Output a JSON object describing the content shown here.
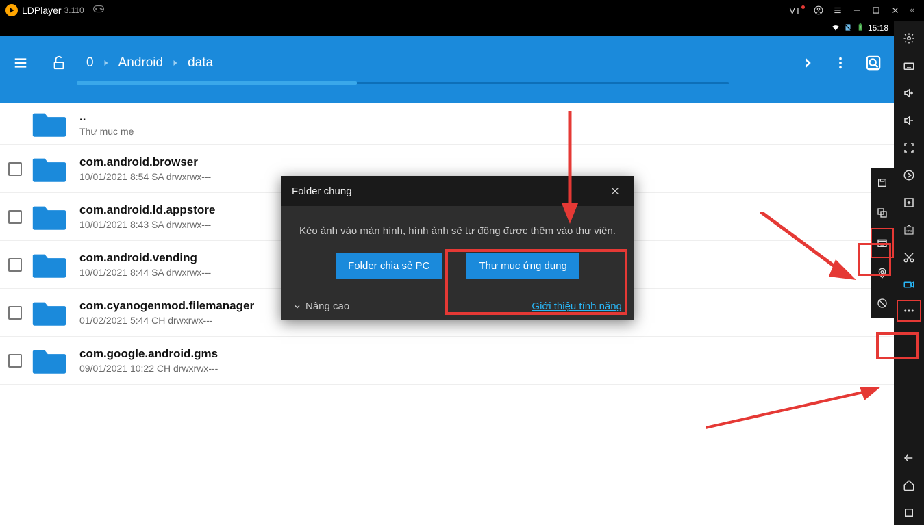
{
  "titlebar": {
    "app_name": "LDPlayer",
    "version": "3.110",
    "vt_label": "VT"
  },
  "statusbar": {
    "time": "15:18"
  },
  "header": {
    "breadcrumb": [
      "0",
      "Android",
      "data"
    ]
  },
  "files": {
    "parent_name": "..",
    "parent_sub": "Thư mục mẹ",
    "items": [
      {
        "name": "com.android.browser",
        "meta": "10/01/2021 8:54 SA   drwxrwx---"
      },
      {
        "name": "com.android.ld.appstore",
        "meta": "10/01/2021 8:43 SA   drwxrwx---"
      },
      {
        "name": "com.android.vending",
        "meta": "10/01/2021 8:44 SA   drwxrwx---"
      },
      {
        "name": "com.cyanogenmod.filemanager",
        "meta": "01/02/2021 5:44 CH   drwxrwx---"
      },
      {
        "name": "com.google.android.gms",
        "meta": "09/01/2021 10:22 CH   drwxrwx---"
      }
    ]
  },
  "dialog": {
    "title": "Folder chung",
    "desc": "Kéo ảnh vào màn hình, hình ảnh sẽ tự động được thêm vào thư viện.",
    "btn_pc": "Folder chia sẻ PC",
    "btn_app": "Thư mục ứng dụng",
    "advanced": "Nâng cao",
    "intro_link": "Giới thiệu tính năng"
  }
}
